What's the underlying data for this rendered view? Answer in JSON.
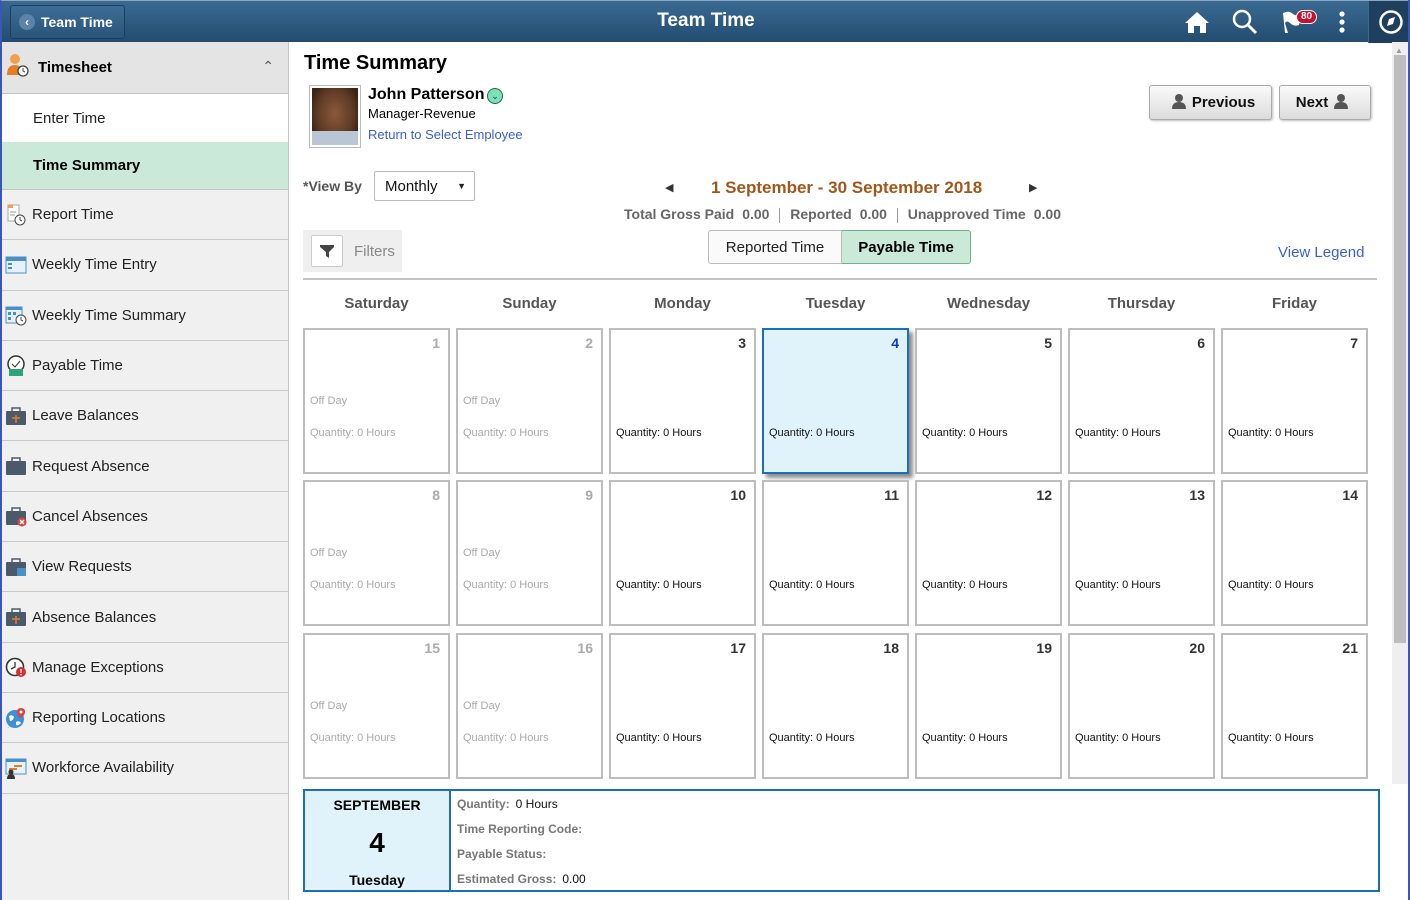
{
  "header": {
    "back_label": "Team Time",
    "title": "Team Time",
    "notification_count": "80",
    "icons": [
      "home-icon",
      "search-icon",
      "notifications-flag-icon",
      "actions-menu-icon",
      "navbar-compass-icon"
    ]
  },
  "sidebar": {
    "group": {
      "label": "Timesheet",
      "icon": "timesheet-person-clock-icon",
      "expanded": true
    },
    "subitems": [
      {
        "label": "Enter Time",
        "active": false
      },
      {
        "label": "Time Summary",
        "active": true
      }
    ],
    "items": [
      {
        "label": "Report Time",
        "icon": "report-time-icon"
      },
      {
        "label": "Weekly Time Entry",
        "icon": "weekly-time-entry-icon"
      },
      {
        "label": "Weekly Time Summary",
        "icon": "weekly-time-summary-icon"
      },
      {
        "label": "Payable Time",
        "icon": "payable-time-icon"
      },
      {
        "label": "Leave Balances",
        "icon": "leave-balances-icon"
      },
      {
        "label": "Request Absence",
        "icon": "request-absence-icon"
      },
      {
        "label": "Cancel Absences",
        "icon": "cancel-absences-icon"
      },
      {
        "label": "View Requests",
        "icon": "view-requests-icon"
      },
      {
        "label": "Absence Balances",
        "icon": "absence-balances-icon"
      },
      {
        "label": "Manage Exceptions",
        "icon": "manage-exceptions-icon"
      },
      {
        "label": "Reporting Locations",
        "icon": "reporting-locations-icon"
      },
      {
        "label": "Workforce Availability",
        "icon": "workforce-availability-icon"
      }
    ]
  },
  "main": {
    "title": "Time Summary",
    "employee": {
      "name": "John Patterson",
      "role": "Manager-Revenue",
      "return_link": "Return to Select Employee"
    },
    "previous_label": "Previous",
    "next_label": "Next",
    "view_by": {
      "label": "*View By",
      "value": "Monthly"
    },
    "period": "1 September - 30 September 2018",
    "totals": {
      "gross_label": "Total Gross Paid",
      "gross_value": "0.00",
      "reported_label": "Reported",
      "reported_value": "0.00",
      "unapproved_label": "Unapproved Time",
      "unapproved_value": "0.00"
    },
    "filters_label": "Filters",
    "toggle": {
      "reported": "Reported Time",
      "payable": "Payable Time",
      "selected": "payable"
    },
    "legend_link": "View Legend",
    "weekdays": [
      "Saturday",
      "Sunday",
      "Monday",
      "Tuesday",
      "Wednesday",
      "Thursday",
      "Friday"
    ],
    "days": [
      {
        "day": "1",
        "off": "Off Day",
        "qty": "Quantity: 0 Hours",
        "offday": true
      },
      {
        "day": "2",
        "off": "Off Day",
        "qty": "Quantity: 0 Hours",
        "offday": true
      },
      {
        "day": "3",
        "off": "",
        "qty": "Quantity: 0 Hours",
        "offday": false
      },
      {
        "day": "4",
        "off": "",
        "qty": "Quantity: 0 Hours",
        "offday": false,
        "selected": true
      },
      {
        "day": "5",
        "off": "",
        "qty": "Quantity: 0 Hours",
        "offday": false
      },
      {
        "day": "6",
        "off": "",
        "qty": "Quantity: 0 Hours",
        "offday": false
      },
      {
        "day": "7",
        "off": "",
        "qty": "Quantity: 0 Hours",
        "offday": false
      },
      {
        "day": "8",
        "off": "Off Day",
        "qty": "Quantity: 0 Hours",
        "offday": true
      },
      {
        "day": "9",
        "off": "Off Day",
        "qty": "Quantity: 0 Hours",
        "offday": true
      },
      {
        "day": "10",
        "off": "",
        "qty": "Quantity: 0 Hours",
        "offday": false
      },
      {
        "day": "11",
        "off": "",
        "qty": "Quantity: 0 Hours",
        "offday": false
      },
      {
        "day": "12",
        "off": "",
        "qty": "Quantity: 0 Hours",
        "offday": false
      },
      {
        "day": "13",
        "off": "",
        "qty": "Quantity: 0 Hours",
        "offday": false
      },
      {
        "day": "14",
        "off": "",
        "qty": "Quantity: 0 Hours",
        "offday": false
      },
      {
        "day": "15",
        "off": "Off Day",
        "qty": "Quantity: 0 Hours",
        "offday": true
      },
      {
        "day": "16",
        "off": "Off Day",
        "qty": "Quantity: 0 Hours",
        "offday": true
      },
      {
        "day": "17",
        "off": "",
        "qty": "Quantity: 0 Hours",
        "offday": false
      },
      {
        "day": "18",
        "off": "",
        "qty": "Quantity: 0 Hours",
        "offday": false
      },
      {
        "day": "19",
        "off": "",
        "qty": "Quantity: 0 Hours",
        "offday": false
      },
      {
        "day": "20",
        "off": "",
        "qty": "Quantity: 0 Hours",
        "offday": false
      },
      {
        "day": "21",
        "off": "",
        "qty": "Quantity: 0 Hours",
        "offday": false
      }
    ],
    "detail": {
      "month": "SEPTEMBER",
      "day": "4",
      "weekday": "Tuesday",
      "quantity_label": "Quantity:",
      "quantity_value": "0 Hours",
      "trc_label": "Time Reporting Code:",
      "trc_value": "",
      "status_label": "Payable Status:",
      "status_value": "",
      "gross_label": "Estimated Gross:",
      "gross_value": "0.00"
    }
  },
  "colors": {
    "header_bg": "#2d5a80",
    "active_green": "#cbe9d8",
    "selected_blue": "#1b6fb8",
    "period_orange": "#a2561a",
    "link_blue": "#3a5fcd"
  }
}
